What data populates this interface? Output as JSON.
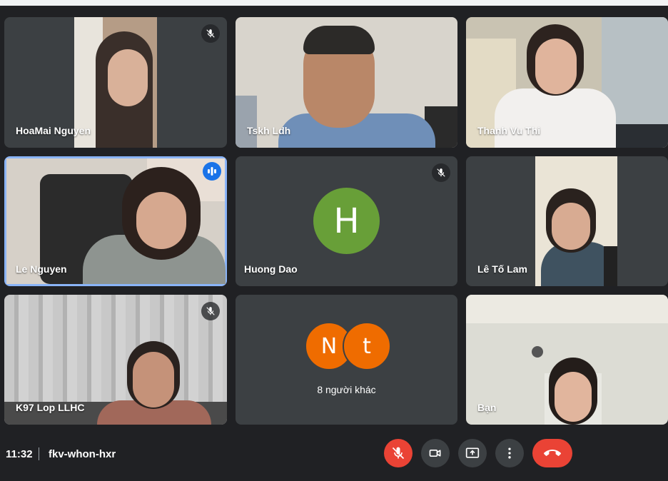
{
  "participants": [
    {
      "name": "HoaMai Nguyen",
      "muted": true
    },
    {
      "name": "Tskh Ldh",
      "muted": false
    },
    {
      "name": "Thanh Vu Thi",
      "muted": false
    },
    {
      "name": "Le Nguyen",
      "speaking": true
    },
    {
      "name": "Huong Dao",
      "muted": true,
      "initial": "H",
      "avatar_color": "#689f38"
    },
    {
      "name": "Lê Tố Lam",
      "muted": false
    },
    {
      "name": "K97 Lop LLHC",
      "muted": true
    },
    {
      "others_label": "8 người khác",
      "initials": [
        "N",
        "t"
      ],
      "avatar_color": "#ef6c00"
    },
    {
      "name": "Bạn"
    }
  ],
  "meeting": {
    "time": "11:32",
    "code": "fkv-whon-hxr"
  },
  "controls": [
    {
      "icon": "mic-off-icon",
      "color": "#ea4335"
    },
    {
      "icon": "camera-icon"
    },
    {
      "icon": "present-screen-icon"
    },
    {
      "icon": "more-options-icon"
    },
    {
      "icon": "end-call-icon",
      "color": "#ea4335"
    }
  ],
  "colors": {
    "background": "#202124",
    "tile": "#3c4043",
    "speaking_border": "#8ab4f8"
  }
}
